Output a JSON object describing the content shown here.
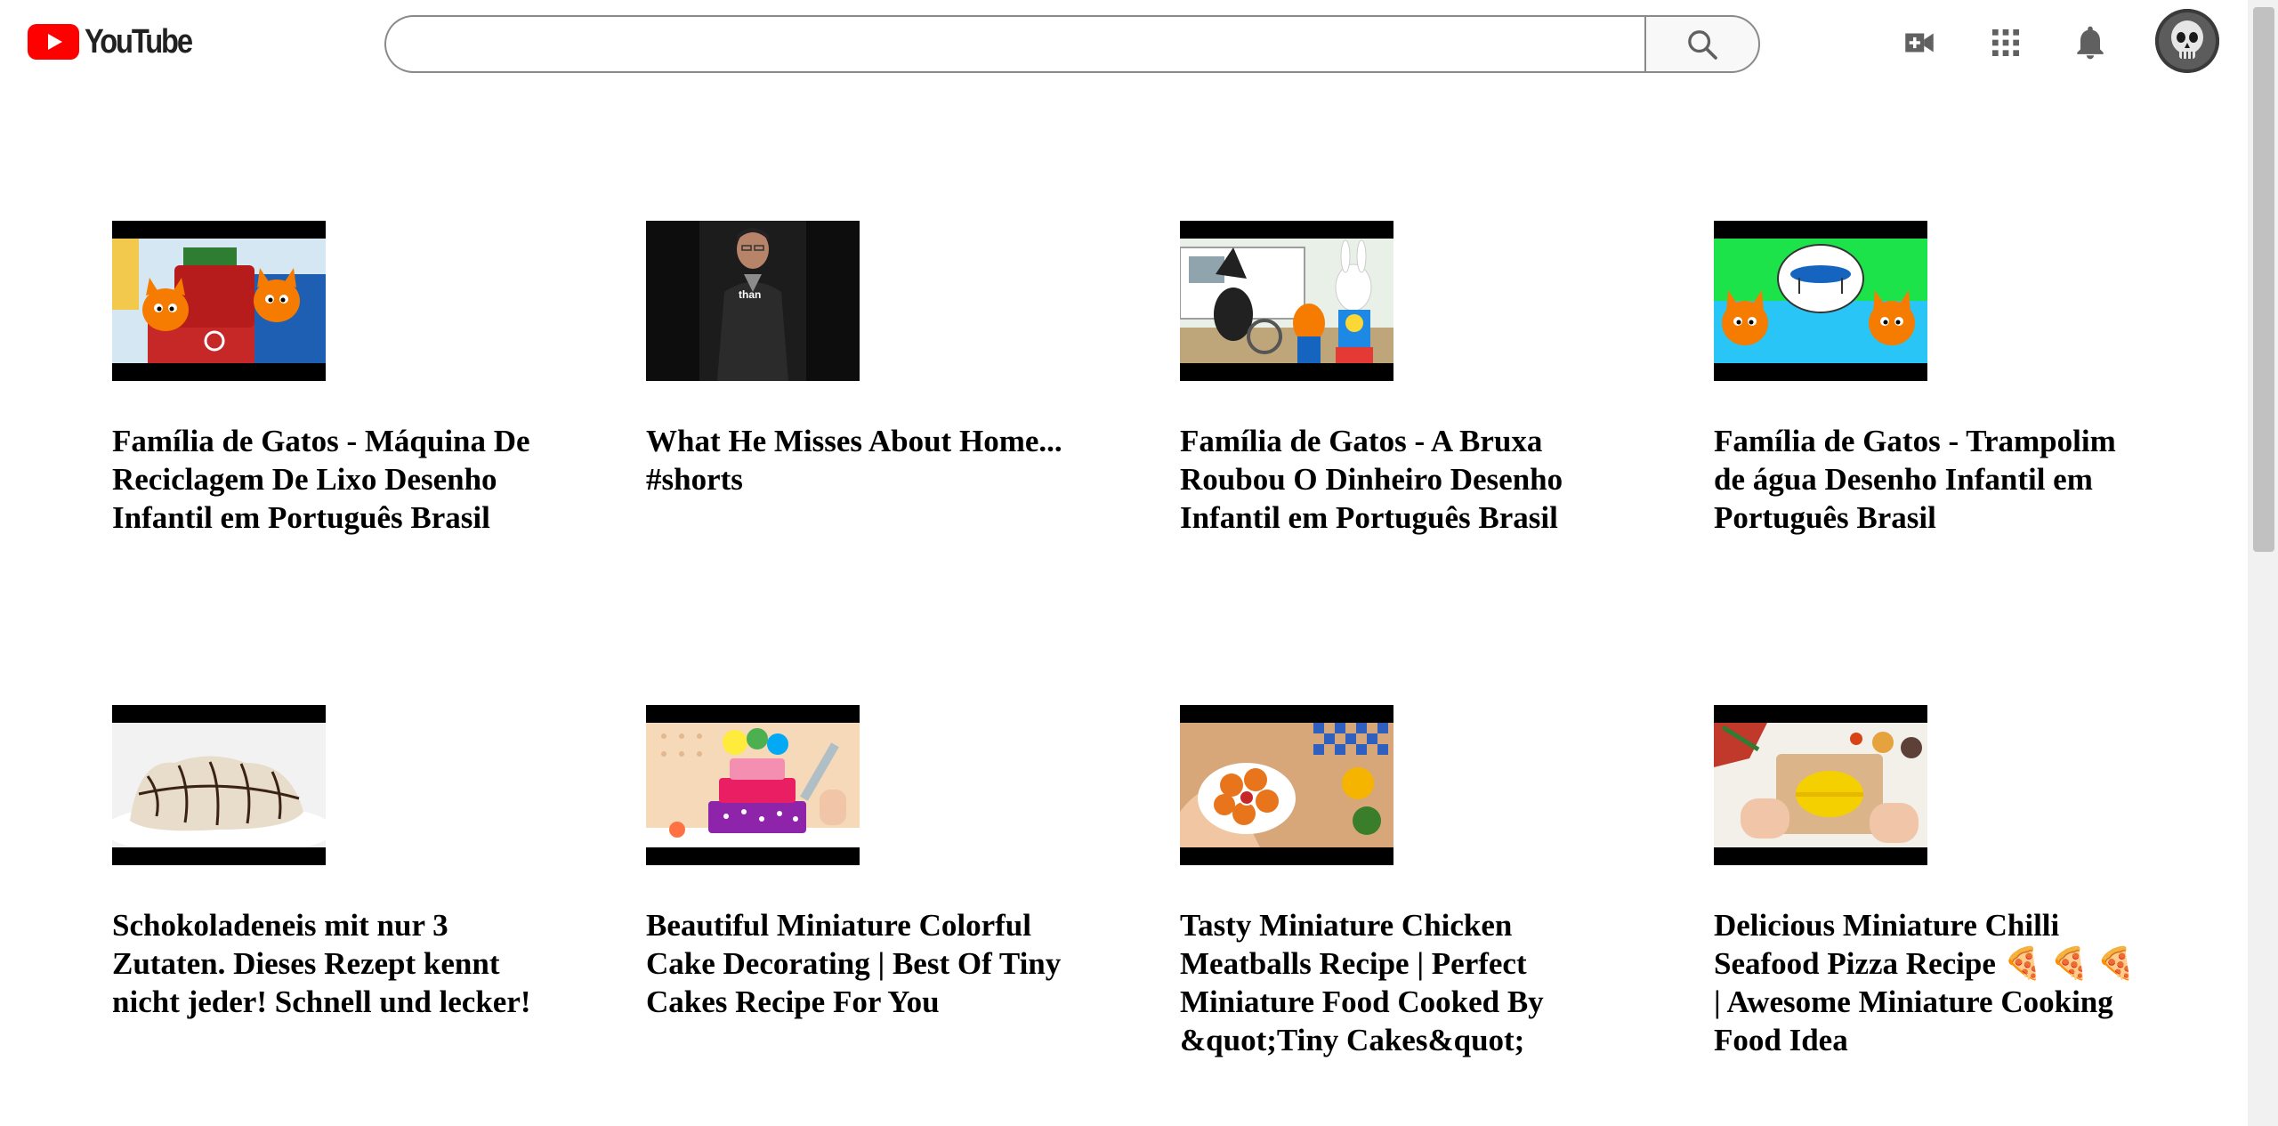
{
  "header": {
    "logo_text": "YouTube",
    "search": {
      "value": "",
      "placeholder": ""
    },
    "icons": [
      "create-video-icon",
      "apps-grid-icon",
      "notifications-bell-icon",
      "avatar"
    ]
  },
  "colors": {
    "brand_red": "#FF0000",
    "icon_gray": "#606060",
    "search_border": "#8a8a8a"
  },
  "videos": [
    {
      "title": "Família de Gatos - Máquina De Reciclagem De Lixo Desenho Infantil em Português Brasil"
    },
    {
      "title": "What He Misses About Home... #shorts",
      "thumb_caption": "than"
    },
    {
      "title": "Família de Gatos - A Bruxa Roubou O Dinheiro Desenho Infantil em Português Brasil"
    },
    {
      "title": "Família de Gatos - Trampolim de água Desenho Infantil em Português Brasil"
    },
    {
      "title": "Schokoladeneis mit nur 3 Zutaten. Dieses Rezept kennt nicht jeder! Schnell und lecker!"
    },
    {
      "title": "Beautiful Miniature Colorful Cake Decorating | Best Of Tiny Cakes Recipe For You"
    },
    {
      "title": "Tasty Miniature Chicken Meatballs Recipe | Perfect Miniature Food Cooked By &quot;Tiny Cakes&quot;"
    },
    {
      "title": "Delicious Miniature Chilli Seafood Pizza Recipe 🍕 🍕 🍕 | Awesome Miniature Cooking Food Idea"
    }
  ]
}
